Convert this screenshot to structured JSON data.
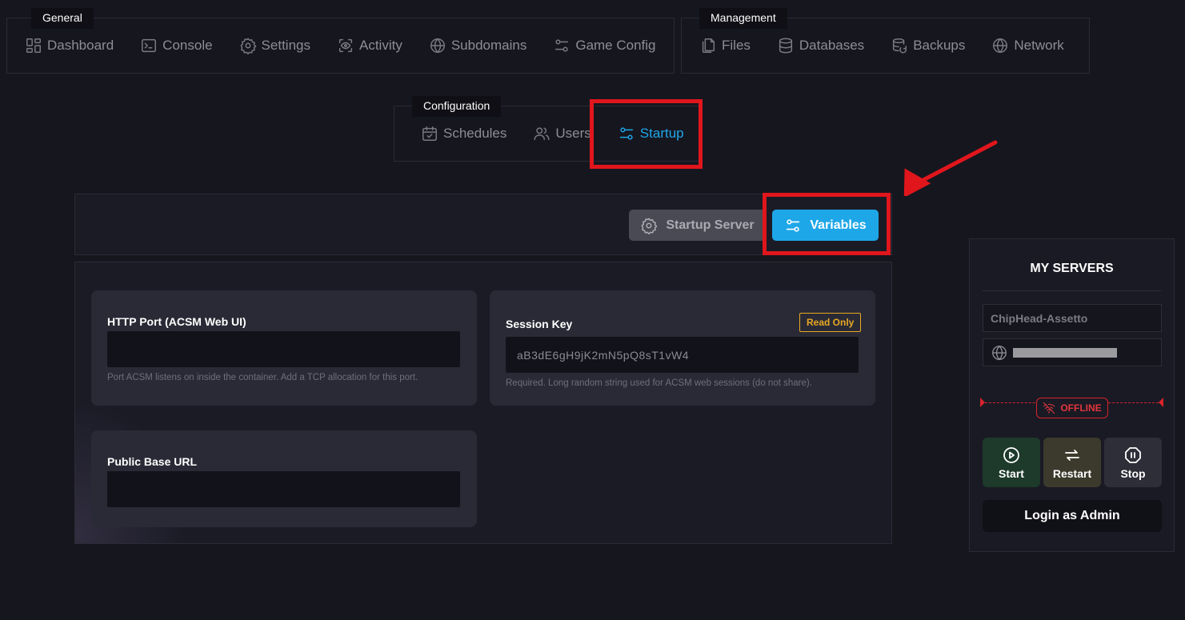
{
  "nav": {
    "general": {
      "title": "General",
      "items": [
        {
          "label": "Dashboard",
          "icon": "dashboard-icon"
        },
        {
          "label": "Console",
          "icon": "console-icon"
        },
        {
          "label": "Settings",
          "icon": "gear-icon"
        },
        {
          "label": "Activity",
          "icon": "activity-icon"
        },
        {
          "label": "Subdomains",
          "icon": "globe-icon"
        },
        {
          "label": "Game Config",
          "icon": "sliders-icon"
        }
      ]
    },
    "management": {
      "title": "Management",
      "items": [
        {
          "label": "Files",
          "icon": "files-icon"
        },
        {
          "label": "Databases",
          "icon": "database-icon"
        },
        {
          "label": "Backups",
          "icon": "backup-icon"
        },
        {
          "label": "Network",
          "icon": "globe-icon"
        }
      ]
    },
    "configuration": {
      "title": "Configuration",
      "items": [
        {
          "label": "Schedules",
          "icon": "calendar-icon"
        },
        {
          "label": "Users",
          "icon": "users-icon"
        },
        {
          "label": "Startup",
          "icon": "sliders-icon",
          "active": true
        }
      ]
    }
  },
  "toolbar": {
    "startup_server_label": "Startup Server",
    "variables_label": "Variables"
  },
  "variables": {
    "http_port": {
      "label": "HTTP Port (ACSM Web UI)",
      "value": "",
      "help": "Port ACSM listens on inside the container. Add a TCP allocation for this port."
    },
    "session_key": {
      "label": "Session Key",
      "badge": "Read Only",
      "value": "aB3dE6gH9jK2mN5pQ8sT1vW4",
      "help": "Required. Long random string used for ACSM web sessions (do not share)."
    },
    "public_base_url": {
      "label": "Public Base URL",
      "value": ""
    }
  },
  "sidebar": {
    "title": "MY SERVERS",
    "server_name": "ChipHead-Assetto",
    "status": "OFFLINE",
    "buttons": {
      "start": "Start",
      "restart": "Restart",
      "stop": "Stop",
      "login": "Login as Admin"
    }
  },
  "colors": {
    "accent": "#1ea7e8",
    "highlight": "#e0161c",
    "readonly_badge": "#e8a824",
    "offline": "#d8232a"
  }
}
